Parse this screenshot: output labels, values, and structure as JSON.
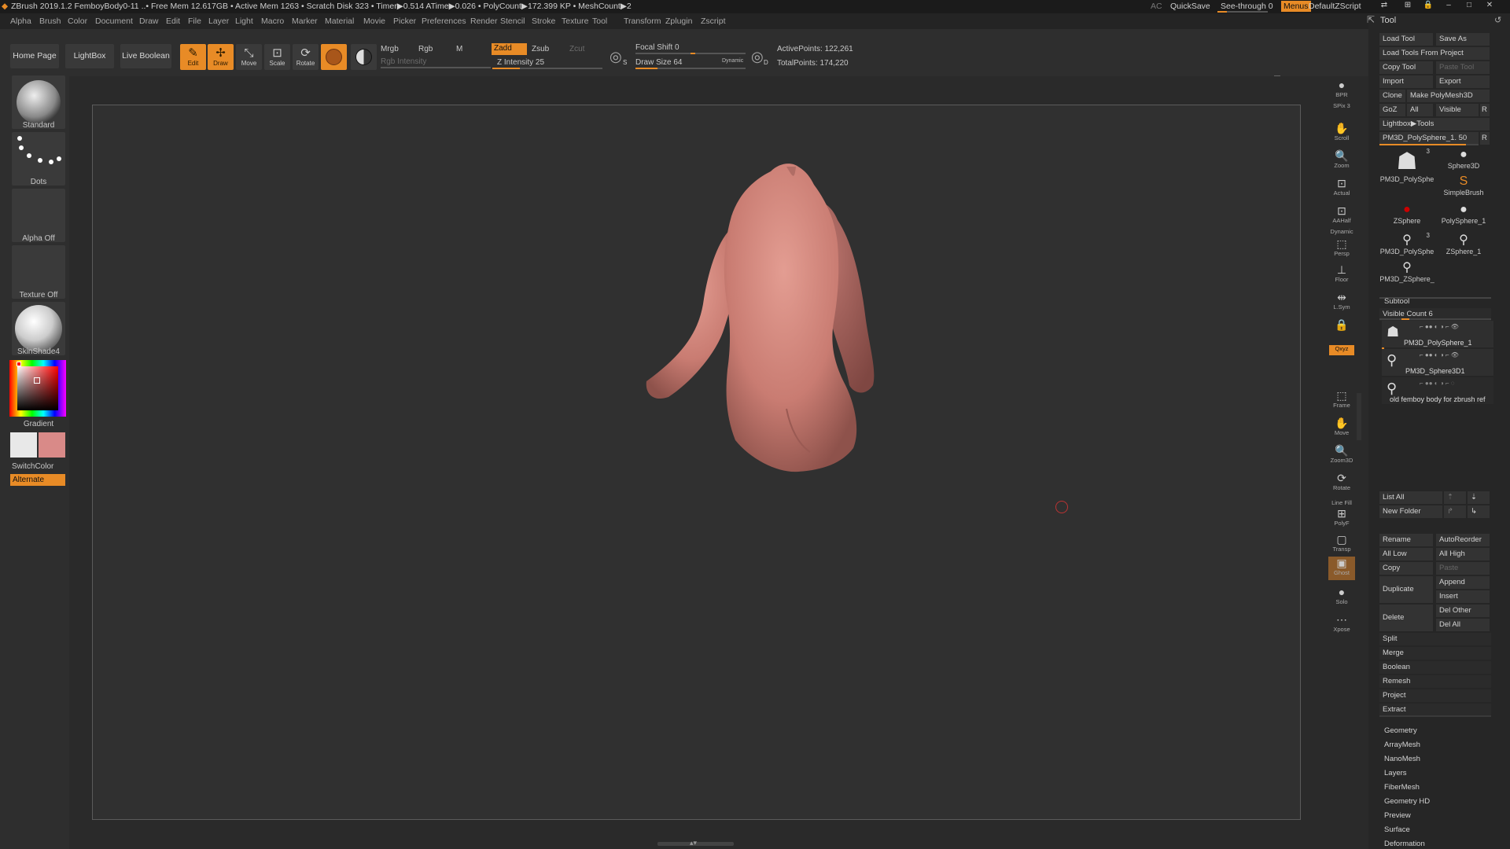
{
  "titlebar": {
    "info": "ZBrush 2019.1.2    FemboyBody0-11    ..• Free Mem 12.617GB • Active Mem 1263 • Scratch Disk 323 • Timer▶0.514 ATime▶0.026 • PolyCount▶172.399 KP • MeshCount▶2",
    "ac": "AC",
    "quicksave": "QuickSave",
    "see_through": "See-through  0",
    "menus": "Menus",
    "script": "DefaultZScript"
  },
  "menubar": [
    "Alpha",
    "Brush",
    "Color",
    "Document",
    "Draw",
    "Edit",
    "File",
    "Layer",
    "Light",
    "Macro",
    "Marker",
    "Material",
    "Movie",
    "Picker",
    "Preferences",
    "Render",
    "Stencil",
    "Stroke",
    "Texture",
    "Tool",
    "Transform",
    "Zplugin",
    "Zscript"
  ],
  "shelf": {
    "home_page": "Home Page",
    "lightbox": "LightBox",
    "live_boolean": "Live Boolean",
    "tools": [
      {
        "name": "edit",
        "label": "Edit",
        "icon": "✎",
        "on": true
      },
      {
        "name": "draw",
        "label": "Draw",
        "icon": "✢",
        "on": true
      },
      {
        "name": "move",
        "label": "Move",
        "icon": "⤡",
        "on": false
      },
      {
        "name": "scale",
        "label": "Scale",
        "icon": "⊡",
        "on": false
      },
      {
        "name": "rotate",
        "label": "Rotate",
        "icon": "⟳",
        "on": false
      }
    ],
    "mrgb": "Mrgb",
    "rgb": "Rgb",
    "m": "M",
    "rgb_intensity": "Rgb Intensity",
    "zadd": "Zadd",
    "zsub": "Zsub",
    "zcut": "Zcut",
    "z_intensity": "Z Intensity 25",
    "z_intensity_value": 25,
    "focal_shift": "Focal Shift 0",
    "focal_shift_value": 0,
    "draw_size": "Draw Size 64",
    "draw_size_fraction": 0.2,
    "dynamic": "Dynamic",
    "active_points": "ActivePoints: 122,261",
    "total_points": "TotalPoints: 174,220",
    "s_letter": "S",
    "d_letter": "D"
  },
  "left": {
    "standard": "Standard",
    "dots": "Dots",
    "alpha_off": "Alpha Off",
    "texture_off": "Texture Off",
    "material": "SkinShade4",
    "gradient": "Gradient",
    "switchcolor": "SwitchColor",
    "alternate": "Alternate",
    "main_color": "#e8e8e8",
    "secondary_color": "#d98a88"
  },
  "right_shelf": [
    {
      "name": "bpr",
      "label": "BPR"
    },
    {
      "name": "spix",
      "label": "SPix 3"
    },
    {
      "name": "scroll",
      "label": "Scroll"
    },
    {
      "name": "zoom",
      "label": "Zoom"
    },
    {
      "name": "actual",
      "label": "Actual"
    },
    {
      "name": "aahalf",
      "label": "AAHalf"
    },
    {
      "name": "dynamic",
      "label": "Dynamic"
    },
    {
      "name": "persp",
      "label": "Persp"
    },
    {
      "name": "floor",
      "label": "Floor"
    },
    {
      "name": "lsym",
      "label": "L.Sym"
    },
    {
      "name": "lock",
      "label": ""
    },
    {
      "name": "xyz",
      "label": "Qxyz"
    },
    {
      "name": "frame",
      "label": "Frame"
    },
    {
      "name": "move",
      "label": "Move"
    },
    {
      "name": "zoom3d",
      "label": "Zoom3D"
    },
    {
      "name": "rotate",
      "label": "Rotate"
    },
    {
      "name": "linefill",
      "label": "Line Fill"
    },
    {
      "name": "polyf",
      "label": "PolyF"
    },
    {
      "name": "transp",
      "label": "Transp"
    },
    {
      "name": "ghost",
      "label": "Ghost"
    },
    {
      "name": "solo",
      "label": "Solo"
    },
    {
      "name": "xpose",
      "label": "Xpose"
    }
  ],
  "tool_panel": {
    "title": "Tool",
    "load_tool": "Load Tool",
    "save_as": "Save As",
    "load_from_project": "Load Tools From Project",
    "copy_tool": "Copy Tool",
    "paste_tool": "Paste Tool",
    "import": "Import",
    "export": "Export",
    "clone": "Clone",
    "make_polymesh": "Make PolyMesh3D",
    "goz": "GoZ",
    "all": "All",
    "visible": "Visible",
    "r": "R",
    "lightbox_tools": "Lightbox▶Tools",
    "current_tool": "PM3D_PolySphere_1. 50",
    "tiles": [
      {
        "name": "pm3d-polysphere",
        "label": "PM3D_PolySphe",
        "count": "3"
      },
      {
        "name": "sphere3d",
        "label": "Sphere3D",
        "count": ""
      },
      {
        "name": "simplebrush",
        "label": "SimpleBrush",
        "count": ""
      },
      {
        "name": "zsphere",
        "label": "ZSphere",
        "count": ""
      },
      {
        "name": "polysphere-1",
        "label": "PolySphere_1",
        "count": ""
      },
      {
        "name": "pm3d-polysphere-2",
        "label": "PM3D_PolySphe",
        "count": "3"
      },
      {
        "name": "zsphere-1",
        "label": "ZSphere_1",
        "count": ""
      },
      {
        "name": "pm3d-zsphere",
        "label": "PM3D_ZSphere_",
        "count": ""
      }
    ],
    "subtool": "Subtool",
    "visible_count": "Visible Count 6",
    "subtools": [
      "PM3D_PolySphere_1",
      "PM3D_Sphere3D1",
      "old femboy body for zbrush ref"
    ],
    "list_all": "List All",
    "new_folder": "New Folder",
    "rename": "Rename",
    "autoreorder": "AutoReorder",
    "all_low": "All Low",
    "all_high": "All High",
    "copy": "Copy",
    "paste": "Paste",
    "duplicate": "Duplicate",
    "append": "Append",
    "insert": "Insert",
    "delete": "Delete",
    "del_other": "Del Other",
    "del_all": "Del All",
    "actions": [
      "Split",
      "Merge",
      "Boolean",
      "Remesh",
      "Project",
      "Extract"
    ],
    "sections": [
      "Geometry",
      "ArrayMesh",
      "NanoMesh",
      "Layers",
      "FiberMesh",
      "Geometry HD",
      "Preview",
      "Surface",
      "Deformation"
    ]
  }
}
